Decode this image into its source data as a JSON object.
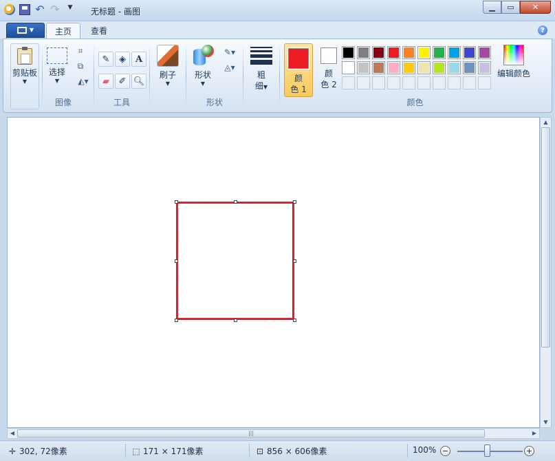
{
  "window": {
    "title": "无标题 - 画图"
  },
  "tabs": {
    "home": "主页",
    "view": "查看"
  },
  "ribbon": {
    "clipboard": {
      "label": "剪贴板"
    },
    "image": {
      "select_label": "选择",
      "group_label": "图像"
    },
    "tools": {
      "group_label": "工具",
      "text_glyph": "A"
    },
    "brushes": {
      "label": "刷子"
    },
    "shapes": {
      "label": "形状",
      "group_label": "形状"
    },
    "size": {
      "label_line1": "粗",
      "label_line2": "细"
    },
    "colors": {
      "color1_line1": "颜",
      "color1_line2": "色 1",
      "color2_line1": "颜",
      "color2_line2": "色 2",
      "edit_label": "编辑颜色",
      "group_label": "颜色",
      "color1_value": "#ed1c24",
      "color2_value": "#ffffff",
      "palette_row1": [
        "#000000",
        "#7f7f7f",
        "#880015",
        "#ed1c24",
        "#ff7f27",
        "#fff200",
        "#22b14c",
        "#00a2e8",
        "#3f48cc",
        "#a349a4"
      ],
      "palette_row2": [
        "#ffffff",
        "#c3c3c3",
        "#b97a57",
        "#ffaec9",
        "#ffc90e",
        "#efe4b0",
        "#b5e61d",
        "#99d9ea",
        "#7092be",
        "#c8bfe7"
      ]
    }
  },
  "canvas": {
    "background": "#ffffff",
    "square_color": "#e0202a"
  },
  "status": {
    "cursor_pos": "302, 72像素",
    "selection_size": "171 × 171像素",
    "image_size": "856 × 606像素",
    "zoom": "100%"
  }
}
